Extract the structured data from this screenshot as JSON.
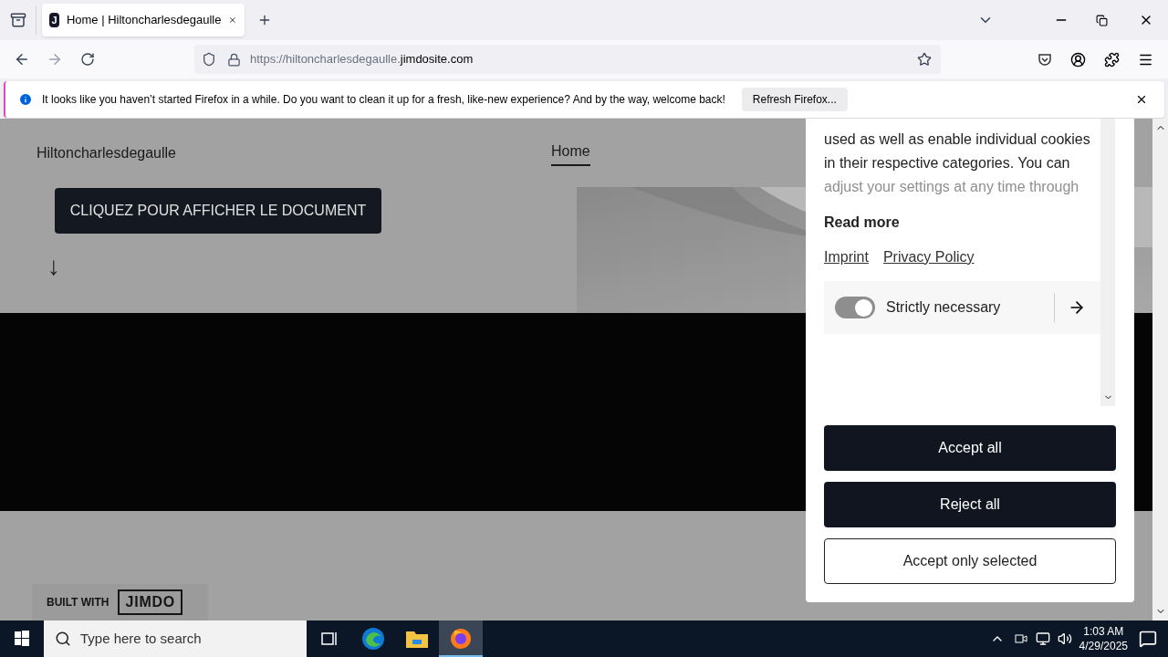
{
  "tabs": [
    {
      "title": "Home | Hiltoncharlesdegaulle",
      "favicon": "J",
      "selected": true
    }
  ],
  "address_bar": {
    "url_prefix": "https://hiltoncharlesdegaulle.",
    "url_domain": "jimdosite.com"
  },
  "notification": {
    "message": "It looks like you haven’t started Firefox in a while. Do you want to clean it up for a fresh, like-new experience? And by the way, welcome back!",
    "button": "Refresh Firefox..."
  },
  "site": {
    "name": "Hiltoncharlesdegaulle",
    "nav": [
      {
        "label": "Home",
        "selected": true
      }
    ],
    "cta": "CLIQUEZ POUR AFFICHER LE DOCUMENT",
    "arrow": "↓",
    "badge_prefix": "BUILT WITH",
    "badge_logo": "JIMDO"
  },
  "cookie_panel": {
    "lines": [
      "used as well as enable individual cookies",
      "in their respective categories. You can"
    ],
    "faded_line": "adjust your settings at any time through",
    "read_more": "Read more",
    "links": [
      "Imprint",
      "Privacy Policy"
    ],
    "categories": [
      {
        "label": "Strictly necessary",
        "on": true
      }
    ],
    "buttons": [
      {
        "label": "Accept all",
        "kind": "primary"
      },
      {
        "label": "Reject all",
        "kind": "primary"
      },
      {
        "label": "Accept only selected",
        "kind": "outline"
      }
    ]
  },
  "taskbar": {
    "search_placeholder": "Type here to search",
    "apps": [
      {
        "kind": "task-view",
        "selected": false
      },
      {
        "kind": "edge",
        "selected": false
      },
      {
        "kind": "explorer",
        "selected": false
      },
      {
        "kind": "firefox",
        "selected": true
      }
    ],
    "time": "1:03 AM",
    "date": "4/29/2025"
  }
}
